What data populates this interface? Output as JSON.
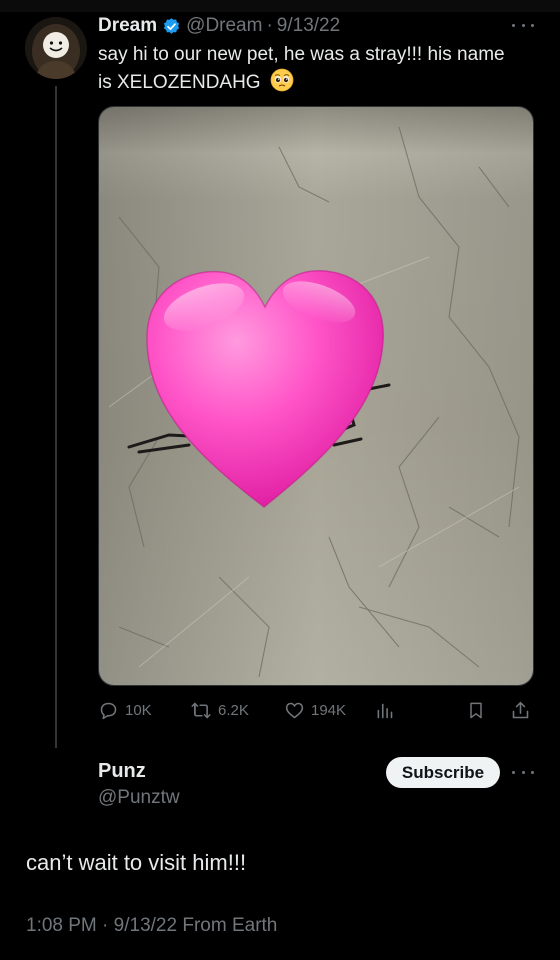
{
  "parent_tweet": {
    "author_name": "Dream",
    "handle": "@Dream",
    "separator": "·",
    "date": "9/13/22",
    "text": "say hi to our new pet, he was a stray!!! his name is XELOZENDAHG",
    "media_alt": "photo of a spider on a cracked wall covered by a pink heart emoji",
    "stats": {
      "replies": "10K",
      "reposts": "6.2K",
      "likes": "194K"
    }
  },
  "reply_tweet": {
    "author_name": "Punz",
    "handle": "@Punztw",
    "subscribe_label": "Subscribe",
    "text": "can’t wait to visit him!!!",
    "time": "1:08 PM",
    "separator": "·",
    "date": "9/13/22",
    "source": "From Earth"
  },
  "colors": {
    "background": "#000000",
    "text": "#e7e9ea",
    "muted": "#71767b",
    "verified": "#1d9bf0",
    "heart": "#ff4fc6"
  }
}
